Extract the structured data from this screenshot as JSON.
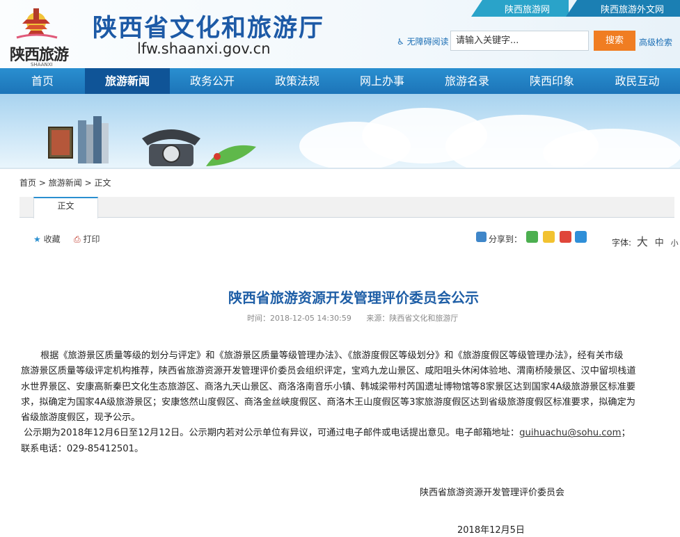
{
  "header": {
    "top_tabs": [
      "陕西旅游网",
      "陕西旅游外文网"
    ],
    "logo_text": "陕西旅游",
    "logo_sub": "SHAANXI",
    "site_title": "陕西省文化和旅游厅",
    "site_url": "lfw.shaanxi.gov.cn",
    "accessibility": "无障碍阅读",
    "search_placeholder": "请输入关键字...",
    "search_button": "搜索",
    "advanced_search": "高级检索",
    "colors": {
      "brand_blue": "#1d5aa6",
      "search_orange": "#f07d22"
    }
  },
  "nav": {
    "items": [
      "首页",
      "旅游新闻",
      "政务公开",
      "政策法规",
      "网上办事",
      "旅游名录",
      "陕西印象",
      "政民互动"
    ],
    "active": "旅游新闻"
  },
  "breadcrumb": {
    "home": "首页",
    "sep": ">",
    "section": "旅游新闻",
    "current": "正文"
  },
  "tab": {
    "label": "正文"
  },
  "tools": {
    "favorite": "收藏",
    "print": "打印",
    "share_label": "分享到：",
    "share_icons": [
      "wechat-icon",
      "qzone-icon",
      "weibo-icon",
      "qq-icon"
    ],
    "font_label": "字体:",
    "font_big": "大",
    "font_mid": "中",
    "font_small": "小"
  },
  "article": {
    "title": "陕西省旅游资源开发管理评价委员会公示",
    "time": "时间：2018-12-05 14:30:59",
    "source": "来源：陕西省文化和旅游厅",
    "para1_line1": "根据《旅游景区质量等级的划分与评定》和《旅游景区质量等级管理办法》、《旅游度假区等级划分》和《旅游度假区等级管理办法》，经有关市级",
    "para1_line2": "旅游景区质量等级评定机构推荐，陕西省旅游资源开发管理评价委员会组织评定，宝鸡九龙山景区、咸阳咀头休闲体验地、渭南桥陵景区、汉中留坝栈道",
    "para1_line3": "水世界景区、安康高新秦巴文化生态旅游区、商洛九天山景区、商洛洛南音乐小镇、韩城梁带村芮国遗址博物馆等8家景区达到国家4A级旅游景区标准要",
    "para1_line4": "求，拟确定为国家4A级旅游景区；安康悠然山度假区、商洛金丝峡度假区、商洛木王山度假区等3家旅游度假区达到省级旅游度假区标准要求，拟确定为",
    "para1_line5": "省级旅游度假区，现予公示。",
    "para2_line1_a": "公示期为2018年12月6日至12月12日。公示期内若对公示单位有异议，可通过电子邮件或电话提出意见。电子邮箱地址：",
    "email": "guihuachu@sohu.com",
    "para2_line1_b": "；",
    "para2_line2": "联系电话：029-85412501。",
    "signature": "陕西省旅游资源开发管理评价委员会",
    "date": "2018年12月5日"
  }
}
